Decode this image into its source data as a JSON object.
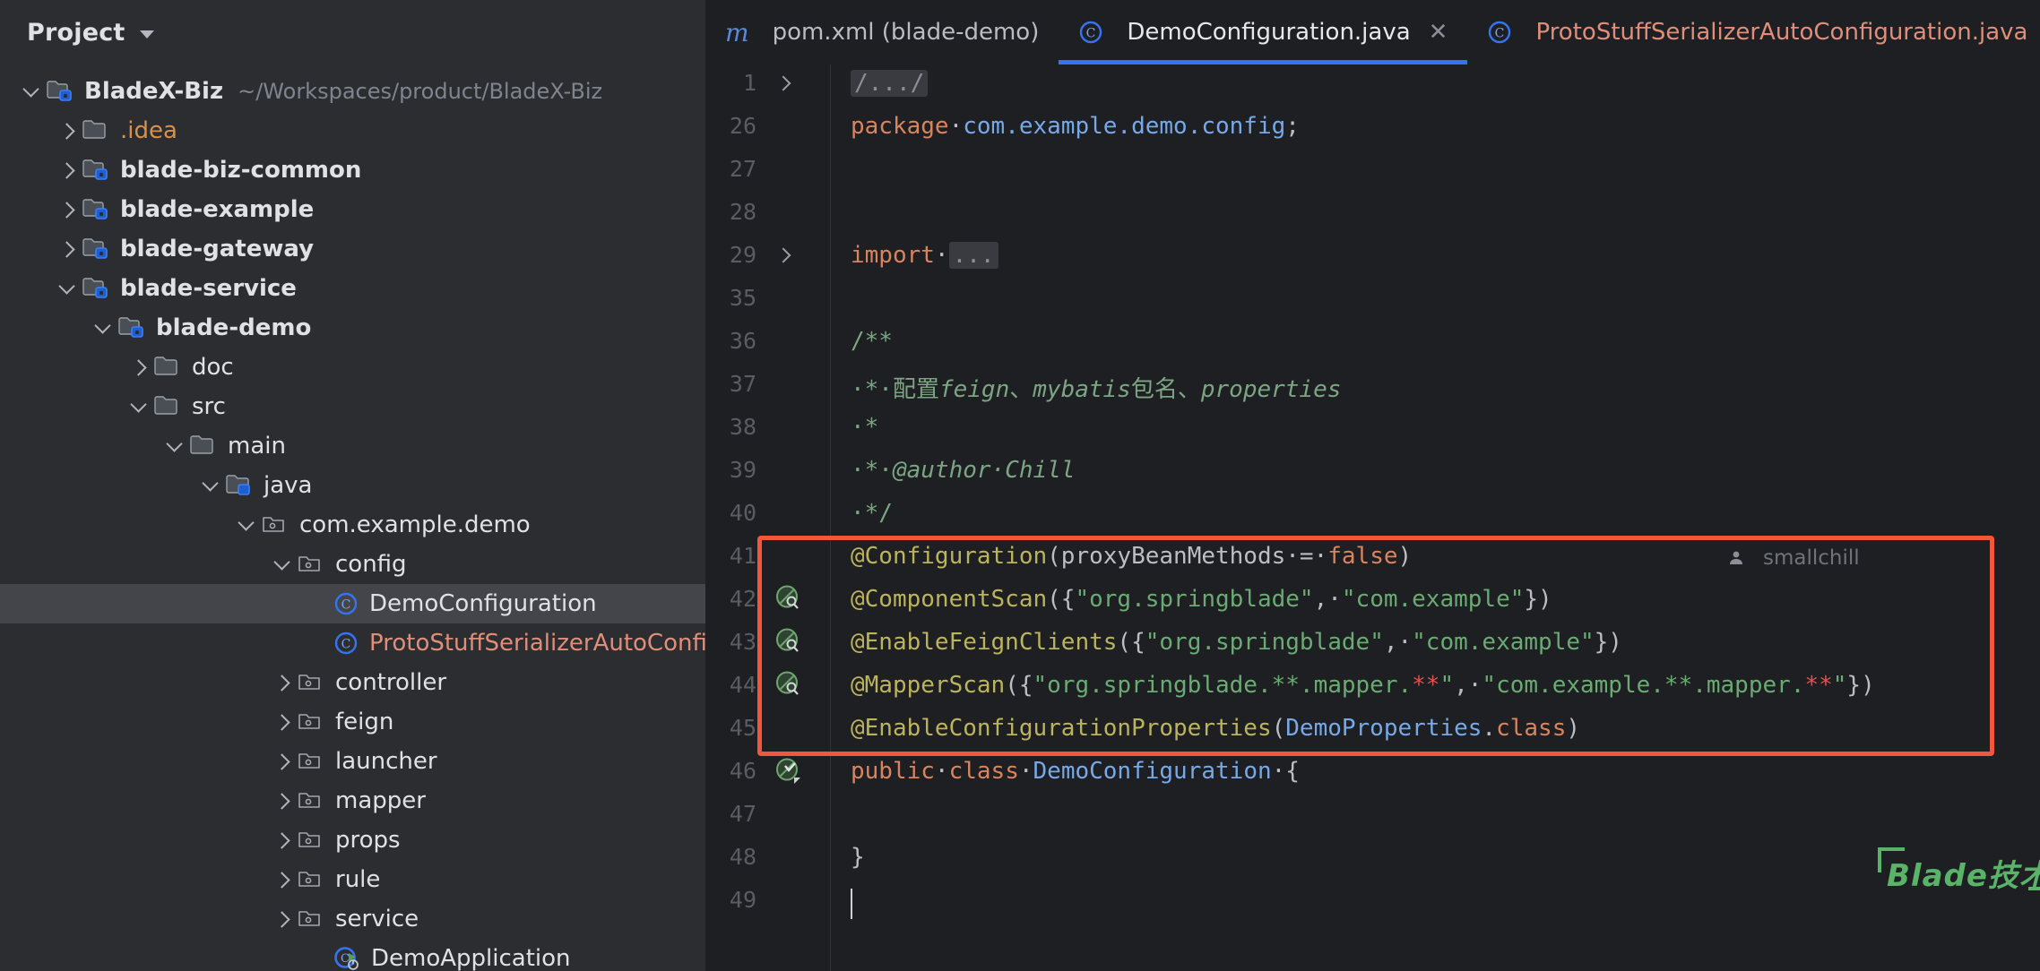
{
  "sidebar": {
    "title": "Project",
    "chevron_icon": "chevron-down-icon",
    "tree": [
      {
        "depth": 0,
        "arrow": "down",
        "icon": "module-folder-icon",
        "label": "BladeX-Biz",
        "bold": true,
        "color": "default",
        "note": "~/Workspaces/product/BladeX-Biz"
      },
      {
        "depth": 1,
        "arrow": "right",
        "icon": "folder-icon",
        "label": ".idea",
        "bold": false,
        "color": "orange",
        "note": ""
      },
      {
        "depth": 1,
        "arrow": "right",
        "icon": "module-folder-icon",
        "label": "blade-biz-common",
        "bold": true,
        "color": "default",
        "note": ""
      },
      {
        "depth": 1,
        "arrow": "right",
        "icon": "module-folder-icon",
        "label": "blade-example",
        "bold": true,
        "color": "default",
        "note": ""
      },
      {
        "depth": 1,
        "arrow": "right",
        "icon": "module-folder-icon",
        "label": "blade-gateway",
        "bold": true,
        "color": "default",
        "note": ""
      },
      {
        "depth": 1,
        "arrow": "down",
        "icon": "module-folder-icon",
        "label": "blade-service",
        "bold": true,
        "color": "default",
        "note": ""
      },
      {
        "depth": 2,
        "arrow": "down",
        "icon": "module-folder-icon",
        "label": "blade-demo",
        "bold": true,
        "color": "default",
        "note": ""
      },
      {
        "depth": 3,
        "arrow": "right",
        "icon": "folder-icon",
        "label": "doc",
        "bold": false,
        "color": "default",
        "note": ""
      },
      {
        "depth": 3,
        "arrow": "down",
        "icon": "folder-icon",
        "label": "src",
        "bold": false,
        "color": "default",
        "note": ""
      },
      {
        "depth": 4,
        "arrow": "down",
        "icon": "folder-icon",
        "label": "main",
        "bold": false,
        "color": "default",
        "note": ""
      },
      {
        "depth": 5,
        "arrow": "down",
        "icon": "source-folder-icon",
        "label": "java",
        "bold": false,
        "color": "default",
        "note": ""
      },
      {
        "depth": 6,
        "arrow": "down",
        "icon": "package-icon",
        "label": "com.example.demo",
        "bold": false,
        "color": "default",
        "note": ""
      },
      {
        "depth": 7,
        "arrow": "down",
        "icon": "package-icon",
        "label": "config",
        "bold": false,
        "color": "default",
        "note": ""
      },
      {
        "depth": 8,
        "arrow": "none",
        "icon": "java-class-icon",
        "label": "DemoConfiguration",
        "bold": false,
        "color": "default",
        "note": "",
        "selected": true
      },
      {
        "depth": 8,
        "arrow": "none",
        "icon": "java-class-icon",
        "label": "ProtoStuffSerializerAutoConfi",
        "bold": false,
        "color": "salmon",
        "note": ""
      },
      {
        "depth": 7,
        "arrow": "right",
        "icon": "package-icon",
        "label": "controller",
        "bold": false,
        "color": "default",
        "note": ""
      },
      {
        "depth": 7,
        "arrow": "right",
        "icon": "package-icon",
        "label": "feign",
        "bold": false,
        "color": "default",
        "note": ""
      },
      {
        "depth": 7,
        "arrow": "right",
        "icon": "package-icon",
        "label": "launcher",
        "bold": false,
        "color": "default",
        "note": ""
      },
      {
        "depth": 7,
        "arrow": "right",
        "icon": "package-icon",
        "label": "mapper",
        "bold": false,
        "color": "default",
        "note": ""
      },
      {
        "depth": 7,
        "arrow": "right",
        "icon": "package-icon",
        "label": "props",
        "bold": false,
        "color": "default",
        "note": ""
      },
      {
        "depth": 7,
        "arrow": "right",
        "icon": "package-icon",
        "label": "rule",
        "bold": false,
        "color": "default",
        "note": ""
      },
      {
        "depth": 7,
        "arrow": "right",
        "icon": "package-icon",
        "label": "service",
        "bold": false,
        "color": "default",
        "note": ""
      },
      {
        "depth": 8,
        "arrow": "none",
        "icon": "runnable-class-icon",
        "label": "DemoApplication",
        "bold": false,
        "color": "default",
        "note": ""
      }
    ]
  },
  "tabs": [
    {
      "icon": "maven-m-icon",
      "label": "pom.xml (blade-demo)",
      "active": false,
      "closable": false,
      "color": "muted"
    },
    {
      "icon": "java-class-icon",
      "label": "DemoConfiguration.java",
      "active": true,
      "closable": true,
      "color": "active"
    },
    {
      "icon": "java-class-icon",
      "label": "ProtoStuffSerializerAutoConfiguration.java",
      "active": false,
      "closable": false,
      "color": "salmon"
    }
  ],
  "editor": {
    "line_numbers": [
      "1",
      "26",
      "27",
      "28",
      "29",
      "35",
      "36",
      "37",
      "38",
      "39",
      "40",
      "41",
      "42",
      "43",
      "44",
      "45",
      "46",
      "47",
      "48",
      "49"
    ],
    "folded_markers": [
      "/.../",
      "..."
    ],
    "author_hint": "smallchill",
    "author_icon": "user-icon",
    "gutter_icons": [
      "bean-icon",
      "bean-icon",
      "bean-icon",
      "bean-check-icon"
    ],
    "lines": [
      {
        "n": "1",
        "text": "/.../"
      },
      {
        "n": "26",
        "text": "package com.example.demo.config;"
      },
      {
        "n": "27",
        "text": ""
      },
      {
        "n": "28",
        "text": ""
      },
      {
        "n": "29",
        "text": "import ..."
      },
      {
        "n": "35",
        "text": ""
      },
      {
        "n": "36",
        "text": "/**"
      },
      {
        "n": "37",
        "text": " * 配置feign、mybatis包名、properties"
      },
      {
        "n": "38",
        "text": " *"
      },
      {
        "n": "39",
        "text": " * @author Chill"
      },
      {
        "n": "40",
        "text": " */"
      },
      {
        "n": "41",
        "text": "@Configuration(proxyBeanMethods = false)"
      },
      {
        "n": "42",
        "text": "@ComponentScan({\"org.springblade\", \"com.example\"})"
      },
      {
        "n": "43",
        "text": "@EnableFeignClients({\"org.springblade\", \"com.example\"})"
      },
      {
        "n": "44",
        "text": "@MapperScan({\"org.springblade.**.mapper.**\", \"com.example.**.mapper.**\"})"
      },
      {
        "n": "45",
        "text": "@EnableConfigurationProperties(DemoProperties.class)"
      },
      {
        "n": "46",
        "text": "public class DemoConfiguration {"
      },
      {
        "n": "47",
        "text": ""
      },
      {
        "n": "48",
        "text": "}"
      },
      {
        "n": "49",
        "text": ""
      }
    ]
  },
  "annotation_box": {
    "color": "#f4553d",
    "highlights_lines": [
      "41",
      "42",
      "43",
      "44",
      "45"
    ]
  },
  "watermark": {
    "text": "Blade技术社区",
    "color": "#59b368"
  }
}
